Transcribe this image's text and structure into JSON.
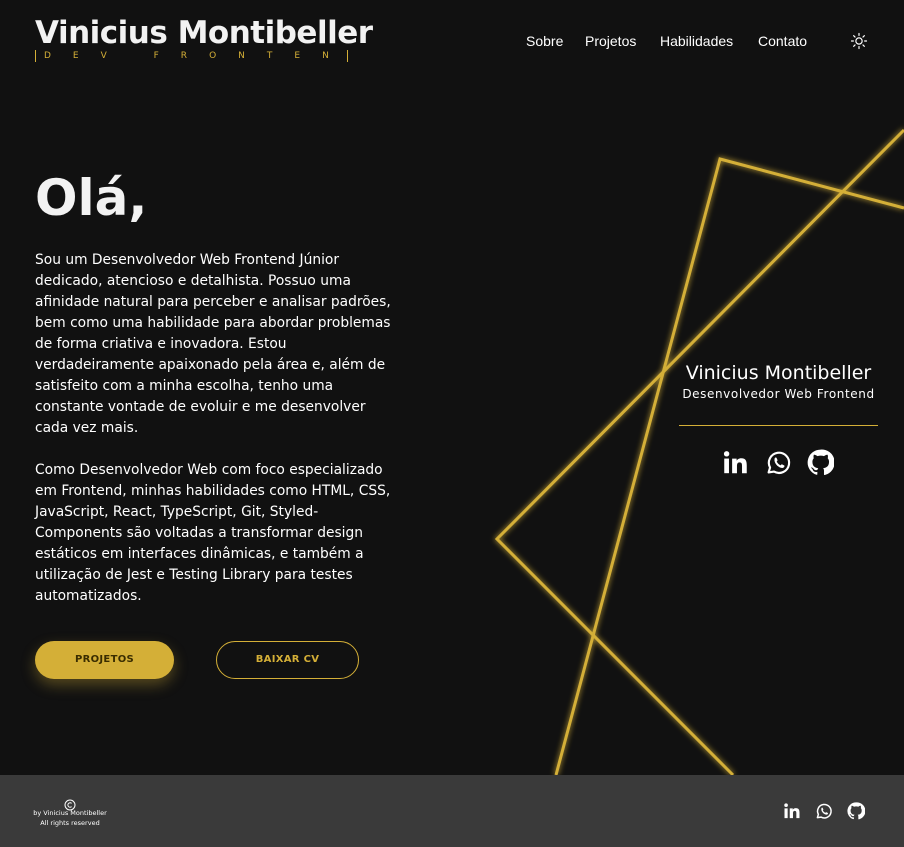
{
  "header": {
    "logo_name": "Vinicius Montibeller",
    "logo_sub": "DEV FRONTEND",
    "nav": [
      "Sobre",
      "Projetos",
      "Habilidades",
      "Contato"
    ],
    "theme_icon": "sun-icon"
  },
  "hero": {
    "title": "Olá,",
    "bio_1": "Sou um Desenvolvedor Web Frontend Júnior dedicado, atencioso e detalhista. Possuo uma afinidade natural para perceber e analisar padrões, bem como uma habilidade para abordar problemas de forma criativa e inovadora. Estou verdadeiramente apaixonado pela área e, além de satisfeito com a minha escolha, tenho uma constante vontade de evoluir e me desenvolver cada vez mais.",
    "bio_2": "Como Desenvolvedor Web com foco especializado em Frontend, minhas habilidades como HTML, CSS, JavaScript, React, TypeScript, Git, Styled-Components são voltadas a transformar design estáticos em interfaces dinâmicas, e também a utilização de Jest e Testing Library para testes automatizados.",
    "btn_projetos": "PROJETOS",
    "btn_cv": "BAIXAR CV"
  },
  "card": {
    "name": "Vinicius Montibeller",
    "role": "Desenvolvedor Web Frontend",
    "social_icons": [
      "linkedin-icon",
      "whatsapp-icon",
      "github-icon"
    ]
  },
  "footer": {
    "copyright_symbol": "©",
    "by": "by Vinicius Montibeller",
    "rights": "All rights reserved",
    "social_icons": [
      "linkedin-icon",
      "whatsapp-icon",
      "github-icon"
    ]
  },
  "colors": {
    "background": "#111111",
    "accent": "#d4af37",
    "footer": "#3a3a3a",
    "text": "#ffffff"
  }
}
